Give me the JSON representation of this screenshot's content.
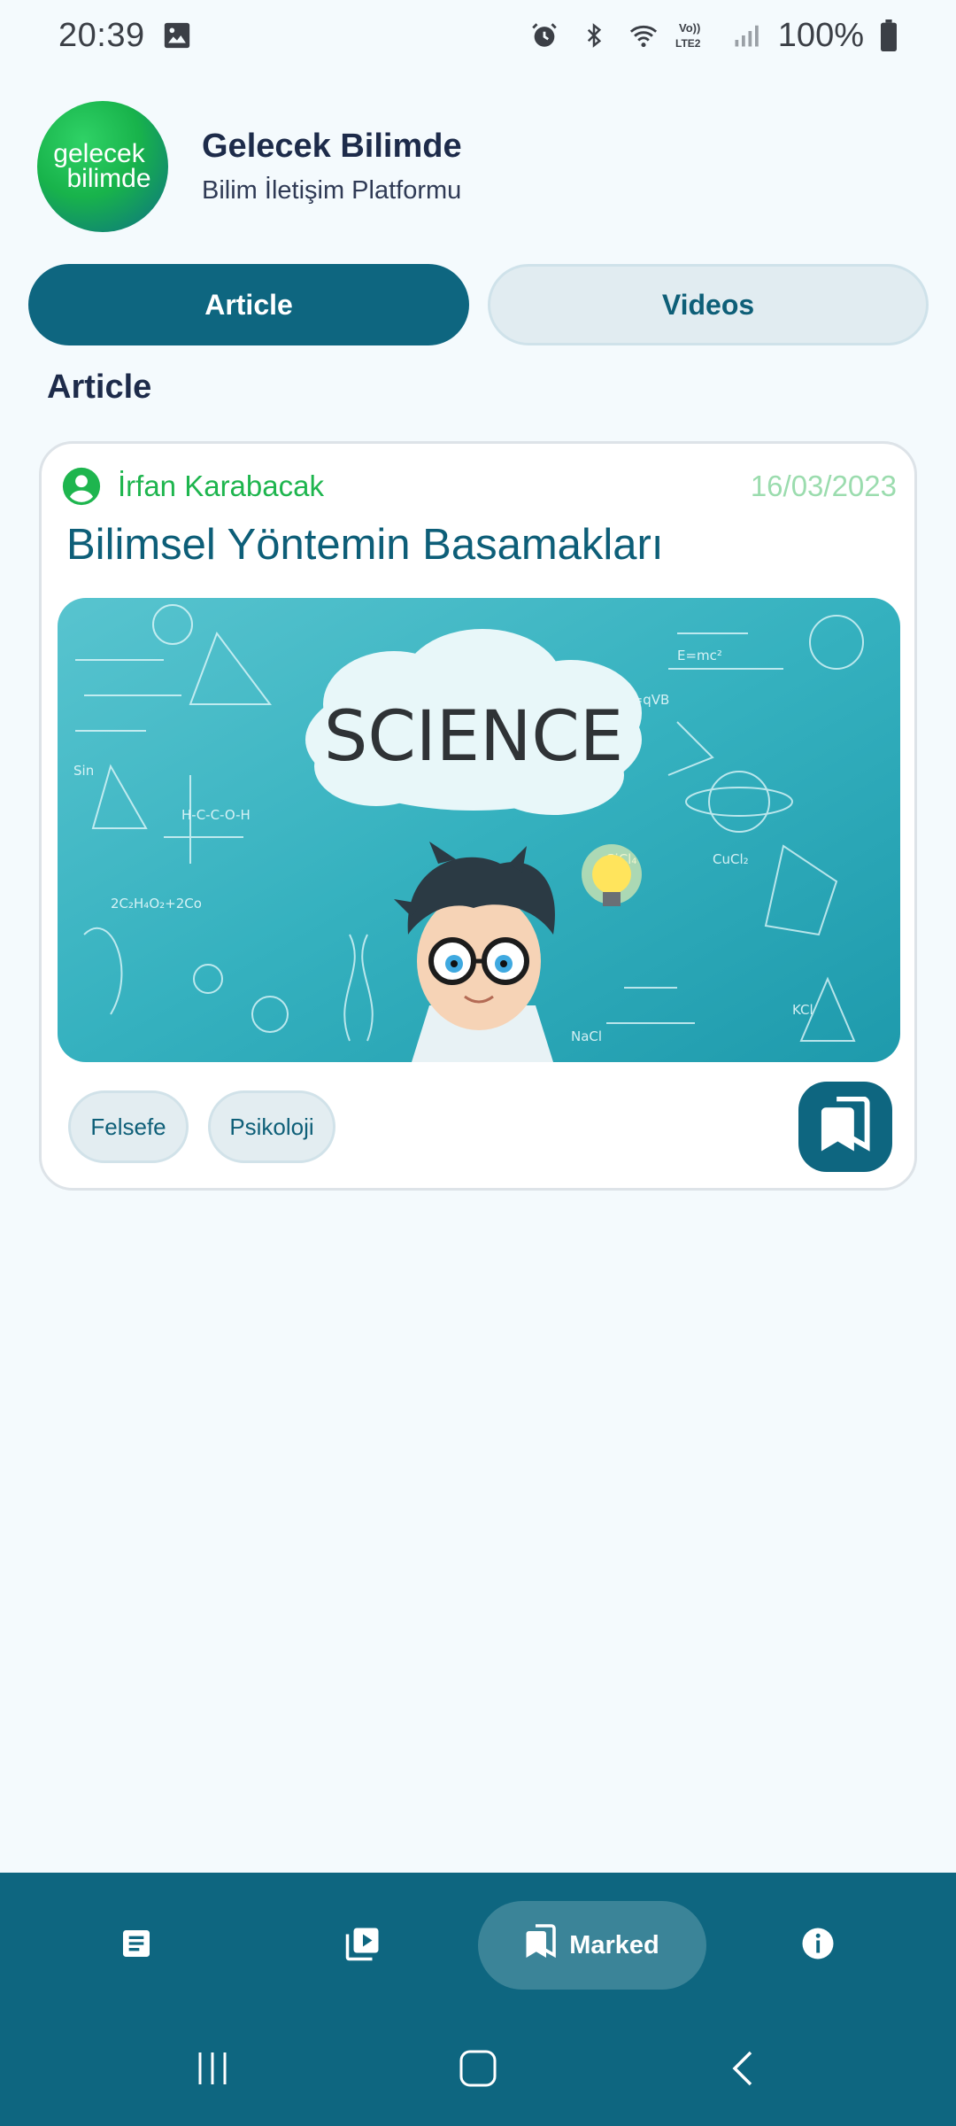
{
  "status_bar": {
    "time": "20:39",
    "battery_text": "100%",
    "icons": [
      "image-icon",
      "alarm-icon",
      "bluetooth-icon",
      "wifi-icon",
      "volte-icon",
      "signal-icon",
      "battery-icon"
    ],
    "volte_text": "Vo)) LTE2"
  },
  "header": {
    "logo_text_line1": "gelecek",
    "logo_text_line2": "bilimde",
    "title": "Gelecek Bilimde",
    "subtitle": "Bilim İletişim Platformu"
  },
  "tabs": [
    {
      "label": "Article",
      "selected": true
    },
    {
      "label": "Videos",
      "selected": false
    }
  ],
  "section_title": "Article",
  "articles": [
    {
      "author": "İrfan Karabacak",
      "date": "16/03/2023",
      "title": "Bilimsel Yöntemin Basamakları",
      "image_text": "SCIENCE",
      "tags": [
        "Felsefe",
        "Psikoloji"
      ],
      "bookmarked": true
    }
  ],
  "bottom_nav": {
    "items": [
      {
        "icon": "article-icon",
        "label": ""
      },
      {
        "icon": "video-library-icon",
        "label": ""
      },
      {
        "icon": "bookmarks-icon",
        "label": "Marked",
        "selected": true
      },
      {
        "icon": "info-icon",
        "label": ""
      }
    ]
  },
  "colors": {
    "primary": "#0e6680",
    "accent_green": "#1eb54e",
    "date_green": "#9bdcae",
    "background": "#f4fafd",
    "title_dark": "#1d2b4a"
  }
}
